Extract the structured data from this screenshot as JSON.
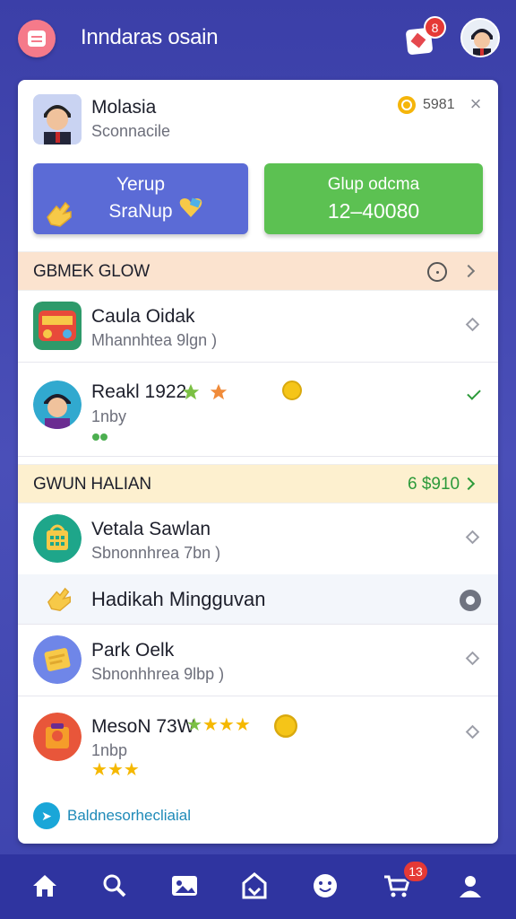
{
  "header": {
    "title": "Inndaras osain",
    "notification_badge": "8",
    "icons": {
      "logo": "app-logo-icon",
      "notification": "notification-card-icon",
      "avatar": "user-avatar"
    }
  },
  "profile": {
    "name": "Molasia",
    "subtitle": "Sconnacile",
    "coins": "5981",
    "close_icon": "close-icon"
  },
  "actions": {
    "blue": {
      "line1": "Yerup",
      "line2": "SraNup",
      "color": "#5b6bd6"
    },
    "green": {
      "line1": "Glup odcma",
      "line2": "12–40080",
      "color": "#5cc152"
    }
  },
  "section1": {
    "title": "GBMEK GLOW",
    "bg": "#fbe3cf"
  },
  "rows": [
    {
      "title": "Caula Oidak",
      "subtitle": "Mhannhtea 9lgn  )",
      "trail": "diamond-icon"
    },
    {
      "title": "Reakl 1922",
      "subtitle": "1nby",
      "trail": "check-icon"
    }
  ],
  "section2": {
    "title": "GWUN HALIAN",
    "amount": "6 $910",
    "bg": "#fdf0cf"
  },
  "rows2": [
    {
      "title": "Vetala Sawlan",
      "subtitle": "Sbnonnhrea 7bn  )"
    },
    {
      "title": "Hadikah Mingguvan"
    },
    {
      "title": "Park Oelk",
      "subtitle": "Sbnonhhrea 9lbp  )"
    },
    {
      "title": "MesoN 73W",
      "subtitle": "1nbp"
    }
  ],
  "footer_link": "Baldnesorhecliaial",
  "bottom_nav": {
    "items": [
      "home-icon",
      "search-icon",
      "photo-card-icon",
      "store-icon",
      "smile-icon",
      "cart-icon",
      "profile-icon"
    ],
    "cart_badge": "13"
  },
  "colors": {
    "primary": "#3b3fa8",
    "accent_green": "#5cc152",
    "accent_blue": "#5b6bd6",
    "badge_red": "#e53935"
  }
}
